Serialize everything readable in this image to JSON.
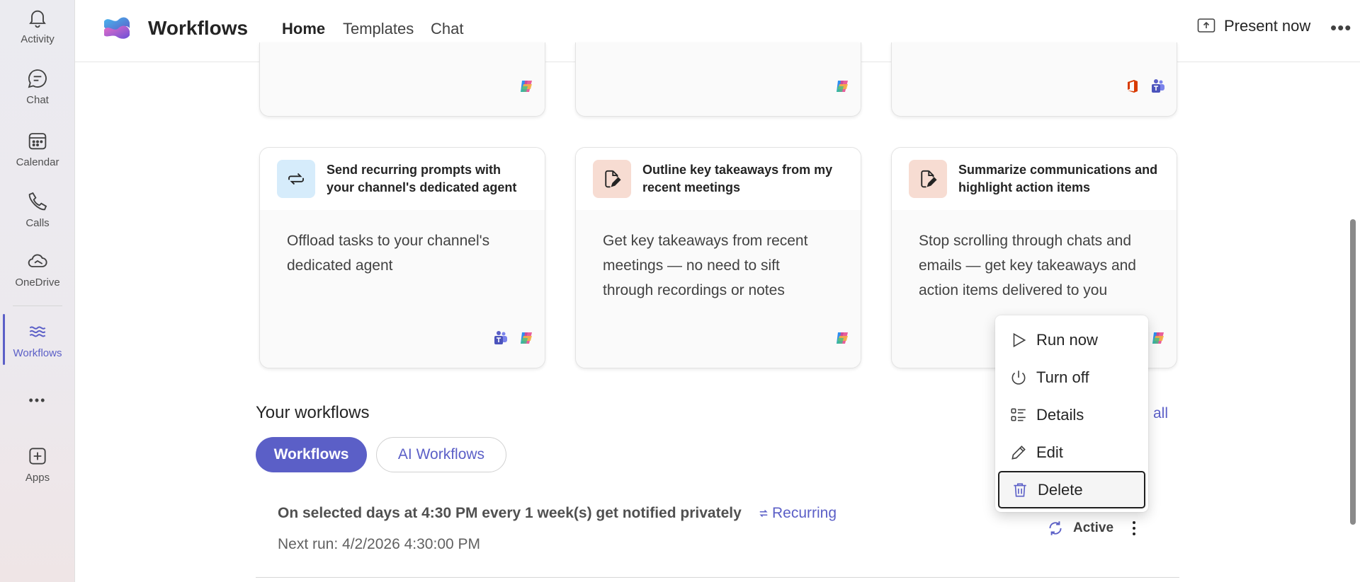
{
  "rail": {
    "items": [
      {
        "label": "Activity",
        "icon": "bell-icon"
      },
      {
        "label": "Chat",
        "icon": "chat-icon"
      },
      {
        "label": "Calendar",
        "icon": "calendar-icon"
      },
      {
        "label": "Calls",
        "icon": "phone-icon"
      },
      {
        "label": "OneDrive",
        "icon": "cloud-icon"
      },
      {
        "label": "Workflows",
        "icon": "workflows-icon"
      },
      {
        "label": "Apps",
        "icon": "add-app-icon"
      }
    ],
    "more": "•••"
  },
  "header": {
    "title": "Workflows",
    "tabs": [
      {
        "label": "Home"
      },
      {
        "label": "Templates"
      },
      {
        "label": "Chat"
      }
    ],
    "present_label": "Present now",
    "more_label": "•••"
  },
  "cards": [
    {
      "title": "Send recurring prompts with your channel's dedicated agent",
      "body": "Offload tasks to your channel's dedicated agent",
      "icon": "recurring-arrows-icon"
    },
    {
      "title": "Outline key takeaways from my recent meetings",
      "body": "Get key takeaways from recent meetings — no need to sift through recordings or notes",
      "icon": "document-edit-icon"
    },
    {
      "title": "Summarize communications and highlight action items",
      "body": "Stop scrolling through chats and emails — get key takeaways and action items delivered to you",
      "icon": "document-edit-icon"
    }
  ],
  "workflows_section": {
    "title": "Your workflows",
    "see_all": "all",
    "pills": [
      {
        "label": "Workflows"
      },
      {
        "label": "AI Workflows"
      }
    ],
    "rows": [
      {
        "description": "On selected days at 4:30 PM every 1 week(s) get notified privately",
        "tag": "Recurring",
        "next_run": "Next run: 4/2/2026 4:30:00 PM",
        "status": "Active"
      }
    ]
  },
  "context_menu": {
    "items": [
      {
        "label": "Run now",
        "icon": "play-icon"
      },
      {
        "label": "Turn off",
        "icon": "power-icon"
      },
      {
        "label": "Details",
        "icon": "details-list-icon"
      },
      {
        "label": "Edit",
        "icon": "pencil-icon"
      },
      {
        "label": "Delete",
        "icon": "trash-icon"
      }
    ]
  },
  "colors": {
    "accent": "#5b5fc7",
    "text": "#242424"
  }
}
